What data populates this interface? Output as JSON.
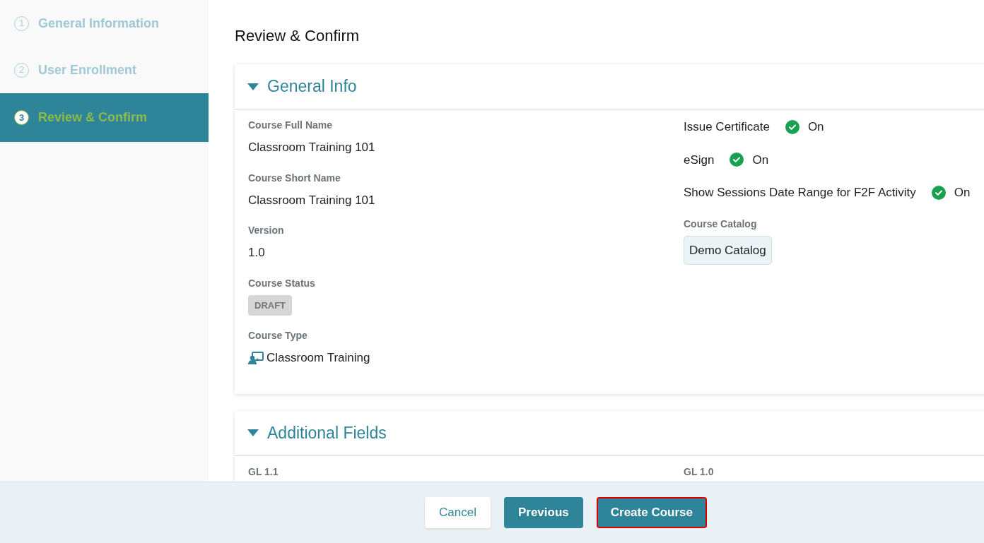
{
  "steps": [
    {
      "number": "1",
      "label": "General Information",
      "selected": false
    },
    {
      "number": "2",
      "label": "User Enrollment",
      "selected": false
    },
    {
      "number": "3",
      "label": "Review & Confirm",
      "selected": true
    }
  ],
  "page_title": "Review & Confirm",
  "sections": [
    {
      "title": "General Info",
      "expanded": true,
      "left_fields": [
        {
          "kind": "text",
          "label": "Course Full Name",
          "value": "Classroom Training 101"
        },
        {
          "kind": "text",
          "label": "Course Short Name",
          "value": "Classroom Training 101"
        },
        {
          "kind": "text",
          "label": "Version",
          "value": "1.0"
        },
        {
          "kind": "badge",
          "label": "Course Status",
          "value": "DRAFT"
        },
        {
          "kind": "icon_text",
          "label": "Course Type",
          "value": "Classroom Training"
        }
      ],
      "right_fields": [
        {
          "kind": "toggle",
          "label": "Issue Certificate",
          "on": true,
          "value": "On"
        },
        {
          "kind": "toggle",
          "label": "eSign",
          "on": true,
          "value": "On"
        },
        {
          "kind": "toggle",
          "label": "Show Sessions Date Range for F2F Activity",
          "on": true,
          "value": "On"
        },
        {
          "kind": "chip",
          "label": "Course Catalog",
          "value": "Demo Catalog"
        }
      ]
    },
    {
      "title": "Additional Fields",
      "expanded": true,
      "left_fields": [
        {
          "kind": "label",
          "label": "GL 1.1"
        }
      ],
      "right_fields": [
        {
          "kind": "label",
          "label": "GL 1.0"
        }
      ]
    }
  ],
  "buttons": [
    {
      "label": "Cancel",
      "kind": "secondary",
      "focused": false
    },
    {
      "label": "Previous",
      "kind": "primary",
      "focused": false
    },
    {
      "label": "Create Course",
      "kind": "primary",
      "focused": true
    }
  ]
}
